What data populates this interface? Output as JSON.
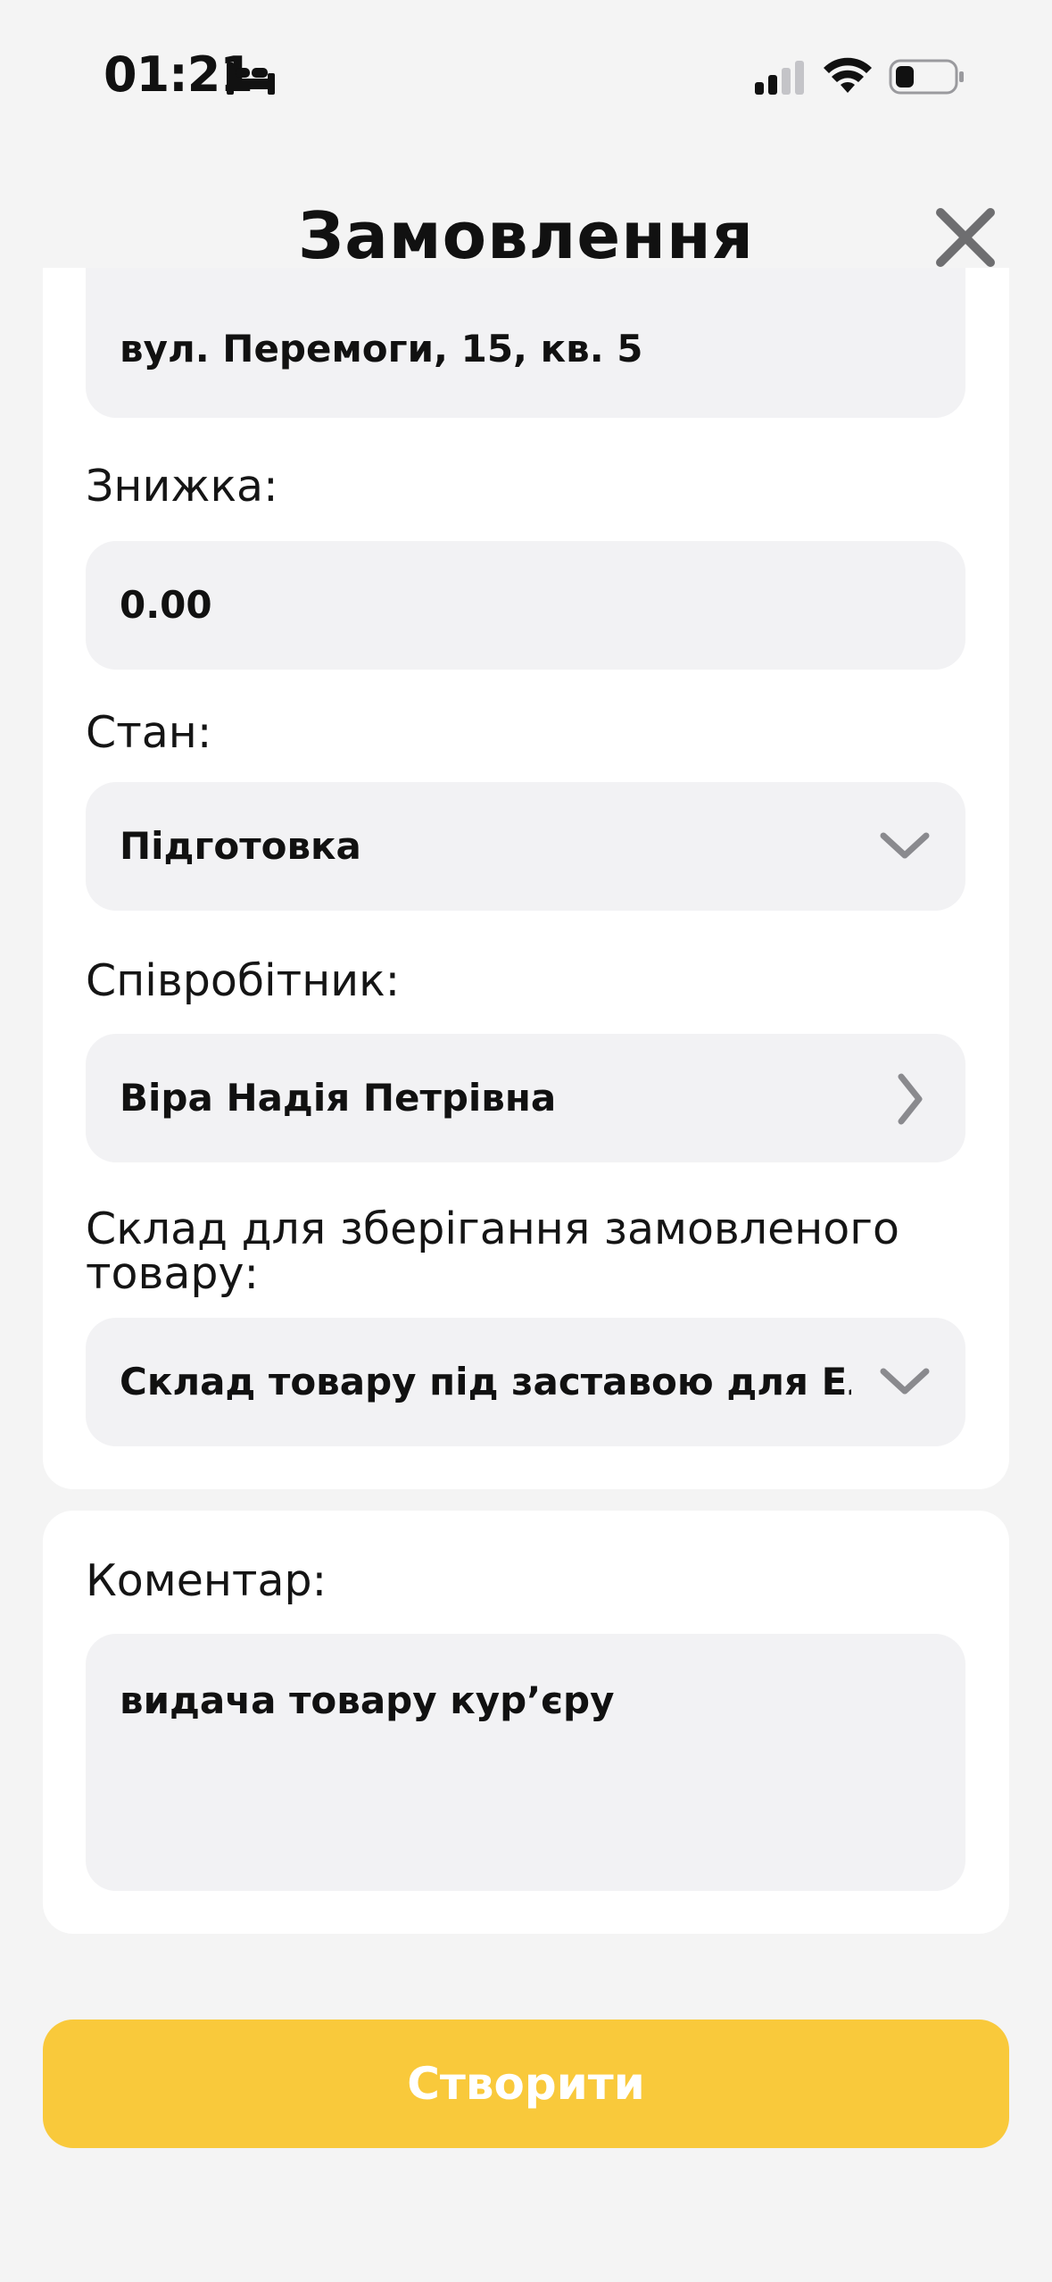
{
  "status_bar": {
    "time": "01:21"
  },
  "header": {
    "title": "Замовлення"
  },
  "form": {
    "address": {
      "value": "вул. Перемоги, 15, кв. 5"
    },
    "discount": {
      "label": "Знижка:",
      "value": "0.00"
    },
    "state": {
      "label": "Стан:",
      "value": "Підготовка"
    },
    "employee": {
      "label": "Співробітник:",
      "value": "Віра Надія Петрівна"
    },
    "warehouse": {
      "label": "Склад для зберігання замовленого товару:",
      "value": "Склад товару під заставою для Еліт"
    },
    "comment": {
      "label": "Коментар:",
      "value": "видача товару кур’єру"
    }
  },
  "actions": {
    "create_label": "Створити"
  },
  "colors": {
    "accent": "#f9c93b",
    "background": "#f4f4f4",
    "field_background": "#f2f2f4",
    "card_background": "#ffffff",
    "chevron": "#8a8a8e"
  },
  "icons": {
    "sleep": "bed-icon",
    "signal": "cellular-signal-icon",
    "wifi": "wifi-icon",
    "battery": "battery-icon",
    "close": "close-icon",
    "dropdown": "chevron-down-icon",
    "navigate": "chevron-right-icon"
  }
}
